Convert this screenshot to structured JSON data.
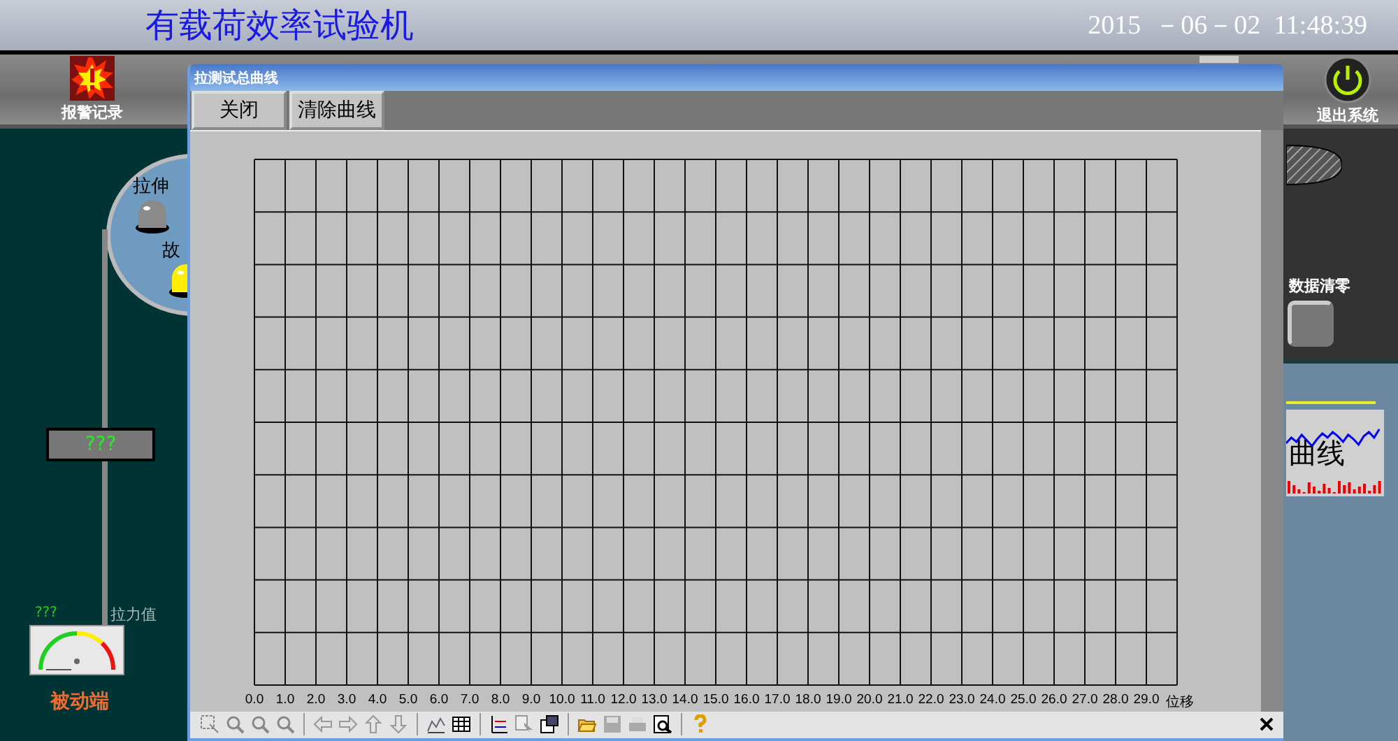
{
  "header": {
    "title": "有载荷效率试验机",
    "datetime": "2015  －06－02  11:48:39"
  },
  "toolbar": {
    "alarm_label": "报警记录",
    "exit_label": "退出系统"
  },
  "left_panel": {
    "lamps": [
      {
        "label": "拉伸",
        "on": false
      },
      {
        "label": "故",
        "on": true
      }
    ],
    "display_value": "???",
    "gauge": {
      "reading": "???",
      "label": "拉力值"
    },
    "side_label": "被动端"
  },
  "right_panel": {
    "reset_label": "数据清零",
    "curve_label": "曲线"
  },
  "dialog": {
    "title": "拉测试总曲线",
    "buttons": [
      "关闭",
      "清除曲线"
    ],
    "grid_axis": {
      "label": "位移",
      "ticks": [
        "0.0",
        "1.0",
        "2.0",
        "3.0",
        "4.0",
        "5.0",
        "6.0",
        "7.0",
        "8.0",
        "9.0",
        "10.0",
        "11.0",
        "12.0",
        "13.0",
        "14.0",
        "15.0",
        "16.0",
        "17.0",
        "18.0",
        "19.0",
        "20.0",
        "21.0",
        "22.0",
        "23.0",
        "24.0",
        "25.0",
        "26.0",
        "27.0",
        "28.0",
        "29.0"
      ]
    }
  }
}
